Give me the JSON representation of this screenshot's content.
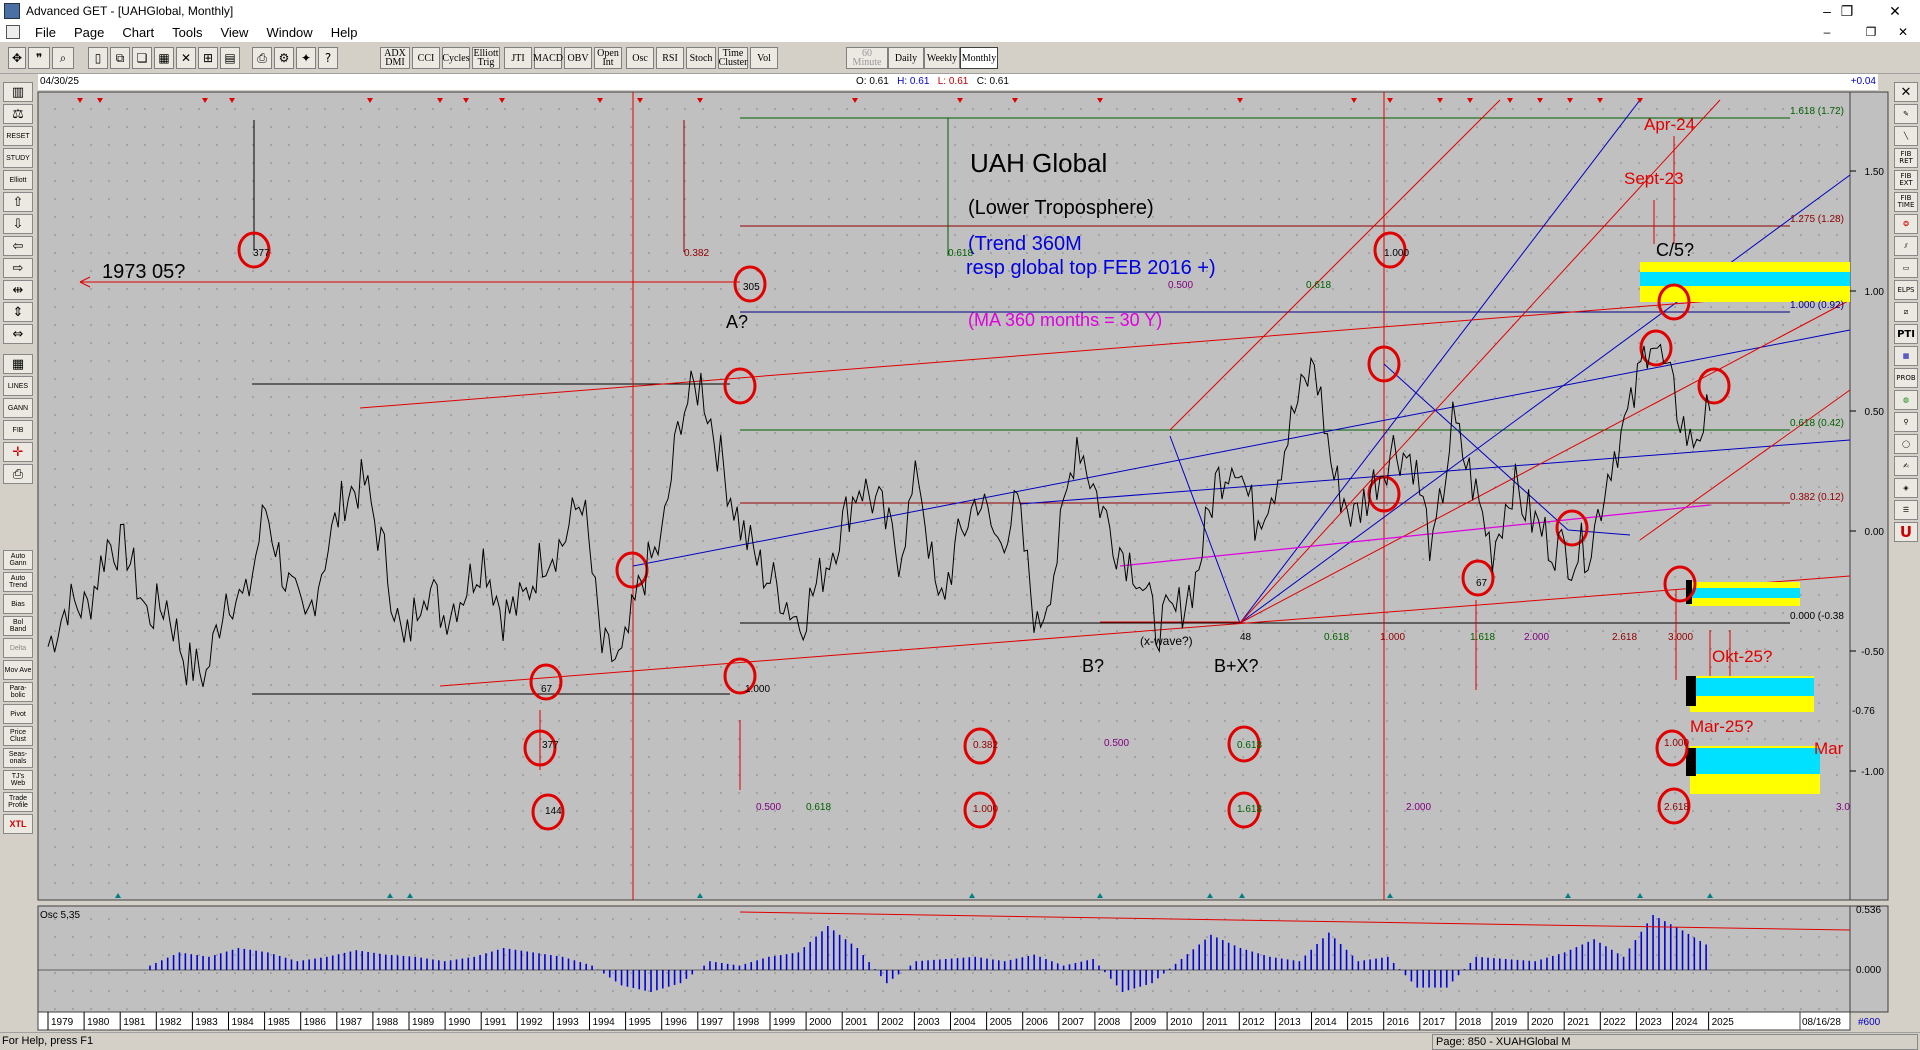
{
  "window": {
    "title": "Advanced GET - [UAHGlobal, Monthly]",
    "controls": [
      "–",
      "❐",
      "✕"
    ]
  },
  "menu": [
    "File",
    "Page",
    "Chart",
    "Tools",
    "View",
    "Window",
    "Help"
  ],
  "toolbar": {
    "studies": [
      "ADX DMI",
      "CCI",
      "Cycles",
      "Elliott Trig",
      "JTI",
      "MACD",
      "OBV",
      "Open Int",
      "Osc",
      "RSI",
      "Stoch",
      "Time Cluster",
      "Vol"
    ],
    "timeframes": [
      "60 Minute",
      "Daily",
      "Weekly",
      "Monthly"
    ],
    "active_timeframe": "Monthly"
  },
  "info": {
    "date": "04/30/25",
    "open": "O: 0.61",
    "high": "H: 0.61",
    "low": "L: 0.61",
    "close": "C: 0.61",
    "right_value": "+0.04"
  },
  "left_tools": [
    "RESET",
    "STUDY",
    "Elliott",
    "LINES",
    "GANN",
    "FIB",
    "Auto Gann",
    "Auto Trend",
    "Bias",
    "Bol Band",
    "Delta",
    "Mov Ave",
    "Para-bolic",
    "Pivot",
    "Price Clust",
    "Seas-onals",
    "TJ's Web",
    "Trade Profile",
    "XTL"
  ],
  "right_tools": [
    "FIB RET",
    "FIB EXT",
    "FIB TIME",
    "ELPS",
    "PTI",
    "PROB"
  ],
  "chart_data": {
    "type": "line",
    "series": [
      {
        "values": [
          -0.48,
          -0.3,
          -0.32,
          -0.05,
          -0.08,
          -0.35,
          -0.3,
          -0.55,
          -0.6,
          -0.25,
          -0.3,
          0.1,
          -0.2,
          -0.4,
          -0.1,
          0.15,
          0.2,
          -0.1,
          -0.5,
          -0.2,
          -0.35,
          -0.25,
          -0.1,
          -0.35,
          -0.3,
          -0.1,
          -0.05,
          0.15,
          -0.5,
          -0.55,
          -0.2,
          -0.05,
          0.5,
          0.62,
          0.3,
          0.02,
          -0.15,
          -0.25,
          -0.38,
          -0.2,
          0.0,
          0.2,
          0.1,
          -0.1,
          0.25,
          -0.33,
          -0.05,
          0.15,
          -0.05,
          0.1,
          -0.42,
          -0.1,
          0.4,
          0.15,
          -0.05,
          -0.15,
          -0.4,
          -0.35,
          -0.2,
          0.2,
          0.32,
          0.05,
          0.2,
          0.5,
          0.7,
          0.22,
          0.05,
          0.2,
          0.35,
          0.3,
          -0.1,
          0.45,
          0.2,
          -0.08,
          0.2,
          0.05,
          -0.05,
          -0.1,
          -0.05,
          0.3,
          0.5,
          0.84,
          0.6,
          0.36,
          0.5
        ]
      }
    ],
    "y_ticks": [
      "1.50",
      "1.00",
      "0.50",
      "0.00",
      "-0.50",
      "-1.00"
    ],
    "x_ticks": [
      "1979",
      "1980",
      "1981",
      "1982",
      "1983",
      "1984",
      "1985",
      "1986",
      "1987",
      "1988",
      "1989",
      "1990",
      "1991",
      "1992",
      "1993",
      "1994",
      "1995",
      "1996",
      "1997",
      "1998",
      "1999",
      "2000",
      "2001",
      "2002",
      "2003",
      "2004",
      "2005",
      "2006",
      "2007",
      "2008",
      "2009",
      "2010",
      "2011",
      "2012",
      "2013",
      "2014",
      "2015",
      "2016",
      "2017",
      "2018",
      "2019",
      "2020",
      "2021",
      "2022",
      "2023",
      "2024",
      "2025"
    ],
    "end_date": "08/16/28",
    "end_value": "#600",
    "price_labels": [
      "-0.76",
      "0.000 (-0.38"
    ],
    "fib_labels": [
      "1.618 (1.72)",
      "1.275 (1.28)",
      "1.000 (0.92)",
      "0.618 (0.42)",
      "0.382 (0.12)"
    ],
    "annotations": {
      "title": "UAH Global",
      "subtitle": "(Lower Troposphere)",
      "trend1": "(Trend 360M",
      "trend2": "resp global top FEB 2016 +)",
      "ma": "(MA 360 months = 30 Y)",
      "note1973": "1973 05?",
      "A": "A?",
      "B": "B?",
      "BX": "B+X?",
      "xwave": "(x-wave?)",
      "C5": "C/5?",
      "apr24": "Apr-24",
      "sept23": "Sept-23",
      "okt25": "Okt-25?",
      "mar25": "Mar-25?",
      "mar": "Mar"
    },
    "circle_labels": [
      "377",
      "305",
      "1.000",
      "67",
      "377",
      "144",
      "1.000",
      "0.382",
      "1.000",
      "0.618",
      "1.618",
      "67",
      "1.000",
      "2.618"
    ],
    "fib_time_labels": [
      "0.382",
      "0.500",
      "0.618",
      "0.500",
      "0.618",
      "1.618",
      "1.000",
      "1.618",
      "2.000",
      "2.618",
      "3.000",
      "48",
      "0.618",
      "1.000",
      "0.500",
      "0.618",
      "2.000",
      "3.0"
    ],
    "osc": {
      "label": "Osc 5,35",
      "values": [
        0.1,
        0.4,
        0.3,
        0.5,
        0.4,
        0.2,
        0.3,
        0.45,
        0.35,
        0.3,
        0.2,
        0.3,
        0.5,
        0.4,
        0.3,
        0.1,
        -0.35,
        -0.5,
        -0.3,
        0.2,
        0.1,
        0.3,
        0.4,
        1.0,
        0.5,
        -0.3,
        0.2,
        0.25,
        0.3,
        0.2,
        0.35,
        0.1,
        0.25,
        -0.5,
        -0.3,
        0.25,
        0.8,
        0.5,
        0.3,
        0.2,
        0.85,
        0.2,
        0.3,
        -0.4,
        -0.4,
        0.3,
        0.25,
        0.2,
        0.4,
        0.7,
        0.3,
        1.25,
        0.9,
        0.5
      ],
      "top_label": "0.536",
      "zero_label": "0.000"
    }
  },
  "status": {
    "help": "For Help, press F1",
    "page": "Page: 850 - XUAHGlobal M"
  }
}
